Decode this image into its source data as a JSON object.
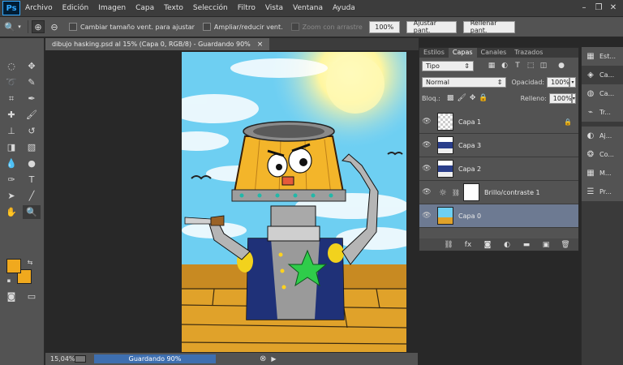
{
  "app": {
    "logo": "Ps"
  },
  "menu": [
    "Archivo",
    "Edición",
    "Imagen",
    "Capa",
    "Texto",
    "Selección",
    "Filtro",
    "Vista",
    "Ventana",
    "Ayuda"
  ],
  "options": {
    "resize_windows_label": "Cambiar tamaño vent. para ajustar",
    "zoom_all_label": "Ampliar/reducir vent.",
    "scrubby_label": "Zoom con arrastre",
    "btn_100": "100%",
    "btn_fit": "Ajustar pant.",
    "btn_fill": "Rellenar pant."
  },
  "document": {
    "tab_title": "dibujo hasking.psd al 15% (Capa 0, RGB/8) - Guardando 90%",
    "close_glyph": "×"
  },
  "status": {
    "zoom": "15,04%",
    "progress_text": "Guardando 90%"
  },
  "colors": {
    "foreground": "#f0a91e",
    "background": "#f0a91e",
    "accent_selection": "#6d7a92"
  },
  "layers_panel": {
    "tabs": [
      "Estilos",
      "Capas",
      "Canales",
      "Trazados"
    ],
    "active_tab": "Capas",
    "filter_label": "Tipo",
    "blend_mode": "Normal",
    "opacity_label": "Opacidad:",
    "opacity_value": "100%",
    "lock_label": "Bloq.:",
    "fill_label": "Relleno:",
    "fill_value": "100%",
    "layers": [
      {
        "name": "Capa 1",
        "locked": true,
        "selected": false
      },
      {
        "name": "Capa 3",
        "locked": false,
        "selected": false
      },
      {
        "name": "Capa 2",
        "locked": false,
        "selected": false
      },
      {
        "name": "Brillo/contraste 1",
        "locked": false,
        "selected": false,
        "adjustment": true
      },
      {
        "name": "Capa 0",
        "locked": false,
        "selected": true
      }
    ]
  },
  "dock": {
    "group1": [
      {
        "icon": "styles-icon",
        "label": "Est..."
      },
      {
        "icon": "layers-icon",
        "label": "Ca..."
      },
      {
        "icon": "channels-icon",
        "label": "Ca..."
      },
      {
        "icon": "paths-icon",
        "label": "Tr..."
      }
    ],
    "group2": [
      {
        "icon": "adjustments-icon",
        "label": "Aj..."
      },
      {
        "icon": "color-icon",
        "label": "Co..."
      },
      {
        "icon": "swatches-icon",
        "label": "M..."
      },
      {
        "icon": "properties-icon",
        "label": "Pr..."
      }
    ]
  }
}
